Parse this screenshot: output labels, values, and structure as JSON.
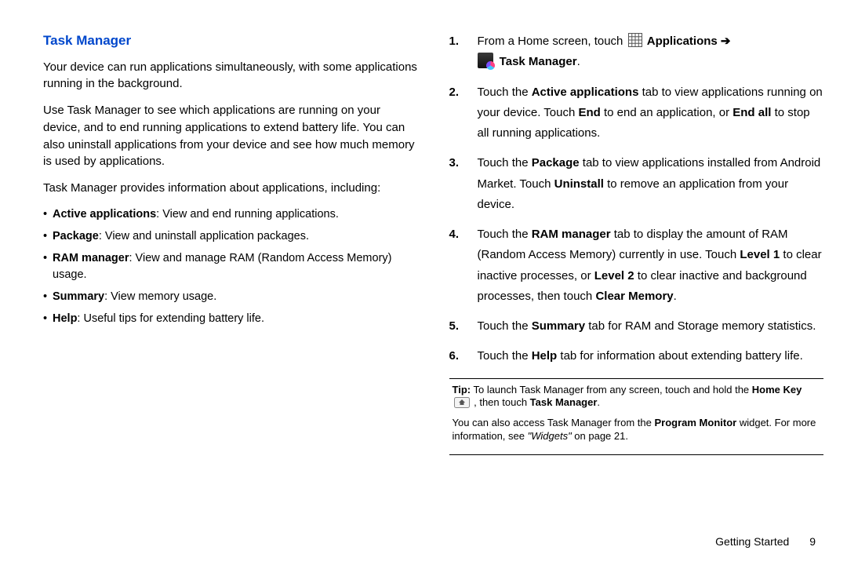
{
  "left": {
    "title": "Task Manager",
    "p1": "Your device can run applications simultaneously, with some applications running in the background.",
    "p2": "Use Task Manager to see which applications are running on your device, and to end running applications to extend battery life. You can also uninstall applications from your device and see how much memory is used by applications.",
    "p3": "Task Manager provides information about applications, including:",
    "bullets": {
      "b1a": "Active applications",
      "b1b": ": View and end running applications.",
      "b2a": "Package",
      "b2b": ": View and uninstall application packages.",
      "b3a": "RAM manager",
      "b3b": ": View and manage RAM (Random Access Memory) usage.",
      "b4a": "Summary",
      "b4b": ": View memory usage.",
      "b5a": "Help",
      "b5b": ": Useful tips for extending battery life."
    }
  },
  "right": {
    "s1": {
      "num": "1.",
      "a": "From a Home screen, touch ",
      "apps": "Applications",
      "arrow": " ➔",
      "tm": "Task Manager",
      "dot": "."
    },
    "s2": {
      "num": "2.",
      "a": "Touch the ",
      "b1": "Active applications",
      "c": " tab to view applications running on your device. Touch ",
      "b2": "End",
      "d": " to end an application, or ",
      "b3": "End all",
      "e": " to stop all running applications."
    },
    "s3": {
      "num": "3.",
      "a": "Touch the ",
      "b1": "Package",
      "c": " tab to view applications installed from Android Market. Touch ",
      "b2": "Uninstall",
      "d": " to remove an application from your device."
    },
    "s4": {
      "num": "4.",
      "a": "Touch the ",
      "b1": "RAM manager",
      "c": "  tab to display the amount of RAM (Random Access Memory) currently in use.  Touch ",
      "b2": "Level 1",
      "d": " to clear inactive processes, or ",
      "b3": "Level 2",
      "e": " to clear inactive and background processes, then touch ",
      "b4": "Clear Memory",
      "f": "."
    },
    "s5": {
      "num": "5.",
      "a": "Touch the ",
      "b1": "Summary",
      "c": " tab for RAM and Storage memory statistics."
    },
    "s6": {
      "num": "6.",
      "a": "Touch the ",
      "b1": "Help",
      "c": "  tab for information about extending battery life."
    },
    "tip": {
      "lead": "Tip:",
      "a": " To launch Task Manager from any screen, touch and hold the ",
      "home": "Home Key",
      "b": " , then touch ",
      "tm": "Task Manager",
      "c": ".",
      "p2a": "You can also access Task Manager from the ",
      "pm": "Program  Monitor",
      "p2b": " widget. For more information, see ",
      "wid": "\"Widgets\"",
      "p2c": " on page 21."
    }
  },
  "footer": {
    "section": "Getting Started",
    "page": "9"
  }
}
